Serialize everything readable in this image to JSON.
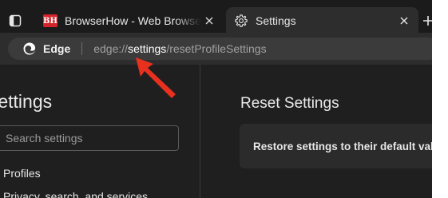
{
  "tabs": [
    {
      "title": "BrowserHow - Web Browser Ho",
      "favicon_text": "BH",
      "favicon_color": "#d3242b",
      "active": false
    },
    {
      "title": "Settings",
      "icon": "gear-icon",
      "active": true
    }
  ],
  "new_tab_icon": "plus-icon",
  "address_bar": {
    "brand_label": "Edge",
    "url_scheme": "edge://",
    "url_host": "settings",
    "url_path": "/resetProfileSettings"
  },
  "sidebar": {
    "title": "Settings",
    "search_placeholder": "Search settings",
    "items": [
      {
        "label": "Profiles"
      },
      {
        "label": "Privacy, search, and services"
      }
    ]
  },
  "main": {
    "title": "Reset Settings",
    "card_label": "Restore settings to their default values"
  },
  "colors": {
    "window_bg": "#1c1c1c",
    "toolbar_bg": "#2d2d2d",
    "annotation_arrow": "#e8301f"
  }
}
